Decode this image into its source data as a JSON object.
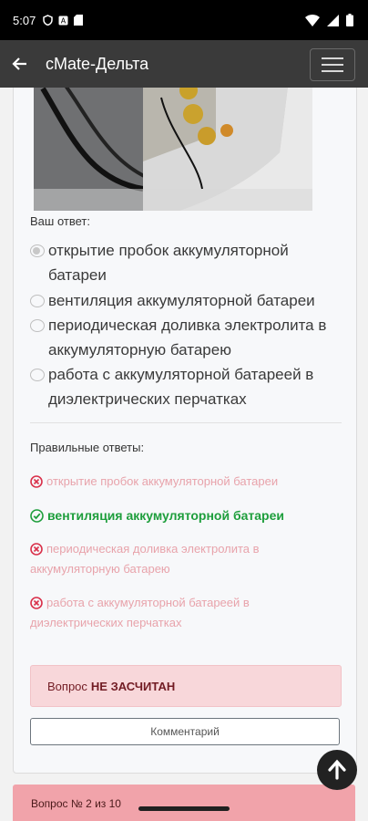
{
  "status_bar": {
    "time": "5:07",
    "left_icons": [
      "shield-icon",
      "a-box-icon",
      "sd-card-icon"
    ],
    "right_icons": [
      "wifi-icon",
      "signal-icon",
      "battery-icon"
    ]
  },
  "app_bar": {
    "title": "cMate-Дельта",
    "back_icon": "arrow-left-icon",
    "menu_icon": "hamburger-icon"
  },
  "question": {
    "your_answer_label": "Ваш ответ:",
    "options": [
      {
        "text": "открытие пробок аккумуляторной батареи",
        "selected": true
      },
      {
        "text": "вентиляция аккумуляторной батареи",
        "selected": false
      },
      {
        "text": "периодическая доливка электролита в аккумуляторную батарею",
        "selected": false
      },
      {
        "text": "работа с аккумуляторной батареей в диэлектрических перчатках",
        "selected": false
      }
    ]
  },
  "results": {
    "title": "Правильные ответы:",
    "items": [
      {
        "text": "открытие пробок аккумуляторной батареи",
        "correct": false
      },
      {
        "text": "вентиляция аккумуляторной батареи",
        "correct": true
      },
      {
        "text": "периодическая доливка электролита в аккумуляторную батарею",
        "correct": false
      },
      {
        "text": "работа с аккумуляторной батареей в диэлектрических перчатках",
        "correct": false
      }
    ]
  },
  "verdict": {
    "prefix": "Вопрос",
    "status": "НЕ ЗАСЧИТАН"
  },
  "comment_button": "Комментарий",
  "next_card_text": "Вопрос № 2 из 10",
  "colors": {
    "app_bar": "#3a3a3a",
    "correct_green": "#1e9e3c",
    "wrong_pink": "#e8a3ab",
    "verdict_bg": "#f8d7da",
    "next_card_bg": "#f1a3aa"
  }
}
